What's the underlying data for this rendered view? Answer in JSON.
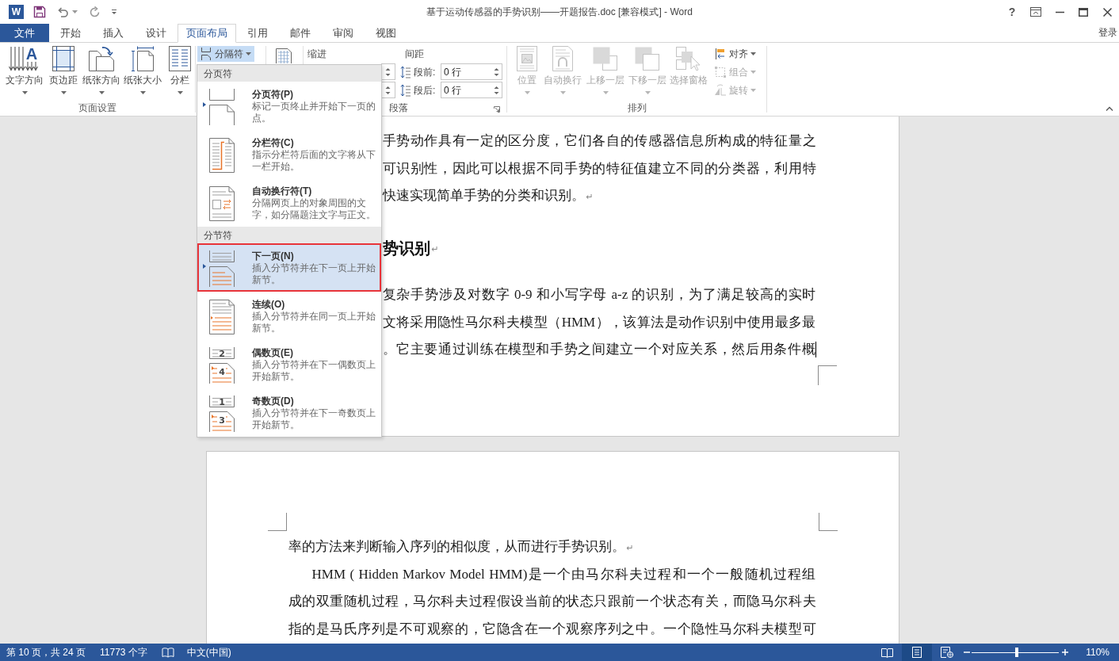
{
  "title_bar": {
    "app_letter": "W",
    "title": "基于运动传感器的手势识别——开题报告.doc [兼容模式] - Word",
    "help": "?"
  },
  "tabs": [
    {
      "label": "文件",
      "kind": "file",
      "selected": false
    },
    {
      "label": "开始",
      "kind": "tab",
      "selected": false
    },
    {
      "label": "插入",
      "kind": "tab",
      "selected": false
    },
    {
      "label": "设计",
      "kind": "tab",
      "selected": false
    },
    {
      "label": "页面布局",
      "kind": "tab",
      "selected": true
    },
    {
      "label": "引用",
      "kind": "tab",
      "selected": false
    },
    {
      "label": "邮件",
      "kind": "tab",
      "selected": false
    },
    {
      "label": "审阅",
      "kind": "tab",
      "selected": false
    },
    {
      "label": "视图",
      "kind": "tab",
      "selected": false
    }
  ],
  "sign_in": "登录",
  "ribbon": {
    "page_setup": {
      "label": "页面设置",
      "buttons": [
        {
          "label": "文字方向",
          "icon_letter": "A"
        },
        {
          "label": "页边距"
        },
        {
          "label": "纸张方向"
        },
        {
          "label": "纸张大小"
        },
        {
          "label": "分栏"
        }
      ]
    },
    "breaks": {
      "label": "分隔符",
      "pressed": true
    },
    "paragraph": {
      "label": "段落",
      "indent_label": "缩进",
      "spacing_label": "间距",
      "spacing": [
        {
          "label": "段前:",
          "value": "0 行"
        },
        {
          "label": "段后:",
          "value": "0 行"
        }
      ]
    },
    "arrange": {
      "label": "排列",
      "buttons": [
        {
          "label": "位置",
          "disabled": true,
          "dropdown": true
        },
        {
          "label": "自动换行",
          "disabled": true,
          "dropdown": true
        },
        {
          "label": "上移一层",
          "disabled": true,
          "dropdown": true
        },
        {
          "label": "下移一层",
          "disabled": true,
          "dropdown": true
        },
        {
          "label": "选择窗格",
          "disabled": true,
          "dropdown": false
        }
      ],
      "small_buttons": [
        {
          "label": "对齐",
          "disabled": false
        },
        {
          "label": "组合",
          "disabled": true
        },
        {
          "label": "旋转",
          "disabled": true
        }
      ]
    }
  },
  "breaks_menu": {
    "sections": [
      {
        "header": "分页符",
        "items": [
          {
            "title": "分页符(P)",
            "description": "标记一页终止并开始下一页的点。",
            "selected": false
          },
          {
            "title": "分栏符(C)",
            "description": "指示分栏符后面的文字将从下一栏开始。",
            "selected": false
          },
          {
            "title": "自动换行符(T)",
            "description": "分隔网页上的对象周围的文字，如分隔题注文字与正文。",
            "selected": false
          }
        ]
      },
      {
        "header": "分节符",
        "items": [
          {
            "title": "下一页(N)",
            "description": "插入分节符并在下一页上开始新节。",
            "selected": true
          },
          {
            "title": "连续(O)",
            "description": "插入分节符并在同一页上开始新节。",
            "selected": false
          },
          {
            "title": "偶数页(E)",
            "description": "插入分节符并在下一偶数页上开始新节。",
            "icon_labels": [
              "2",
              "4"
            ],
            "selected": false
          },
          {
            "title": "奇数页(D)",
            "description": "插入分节符并在下一奇数页上开始新节。",
            "icon_labels": [
              "1",
              "3"
            ],
            "selected": false
          }
        ]
      }
    ]
  },
  "document": {
    "pages": [
      {
        "kind": "page_end",
        "paragraphs": [
          {
            "kind": "body",
            "lines": [
              "手势动作具有一定的区分度，它们各自的传感器信息所构成的特征量之",
              "可识别性，因此可以根据不同手势的特征值建立不同的分类器，利用特",
              "快速实现简单手势的分类和识别。"
            ],
            "end_mark": "↵"
          },
          {
            "kind": "heading",
            "lines": [
              "势识别"
            ],
            "end_mark": "↵"
          },
          {
            "kind": "body",
            "lines": [
              "复杂手势涉及对数字 0-9 和小写字母 a-z 的识别，为了满足较高的实时",
              "文将采用隐性马尔科夫模型（HMM），该算法是动作识别中使用最多最",
              "。它主要通过训练在模型和手势之间建立一个对应关系，然后用条件概"
            ],
            "cursor": true
          }
        ]
      },
      {
        "kind": "page_start",
        "paragraphs": [
          {
            "kind": "body",
            "lines": [
              "率的方法来判断输入序列的相似度，从而进行手势识别。"
            ],
            "end_mark": "↵"
          },
          {
            "kind": "indented_body",
            "lines": [
              "HMM ( Hidden Markov Model HMM)是一个由马尔科夫过程和一个一般随机过程组",
              "成的双重随机过程，马尔科夫过程假设当前的状态只跟前一个状态有关，而隐马尔科夫",
              "指的是马氏序列是不可观察的，它隐含在一个观察序列之中。一个隐性马尔科夫模型可"
            ]
          }
        ]
      }
    ]
  },
  "status_bar": {
    "page_info": "第 10 页，共 24 页",
    "word_count": "11773 个字",
    "language": "中文(中国)",
    "views": [
      {
        "kind": "read",
        "selected": false
      },
      {
        "kind": "print",
        "selected": true
      },
      {
        "kind": "web",
        "selected": false
      }
    ],
    "zoom": {
      "level": 0.52,
      "reading": "110%"
    }
  }
}
